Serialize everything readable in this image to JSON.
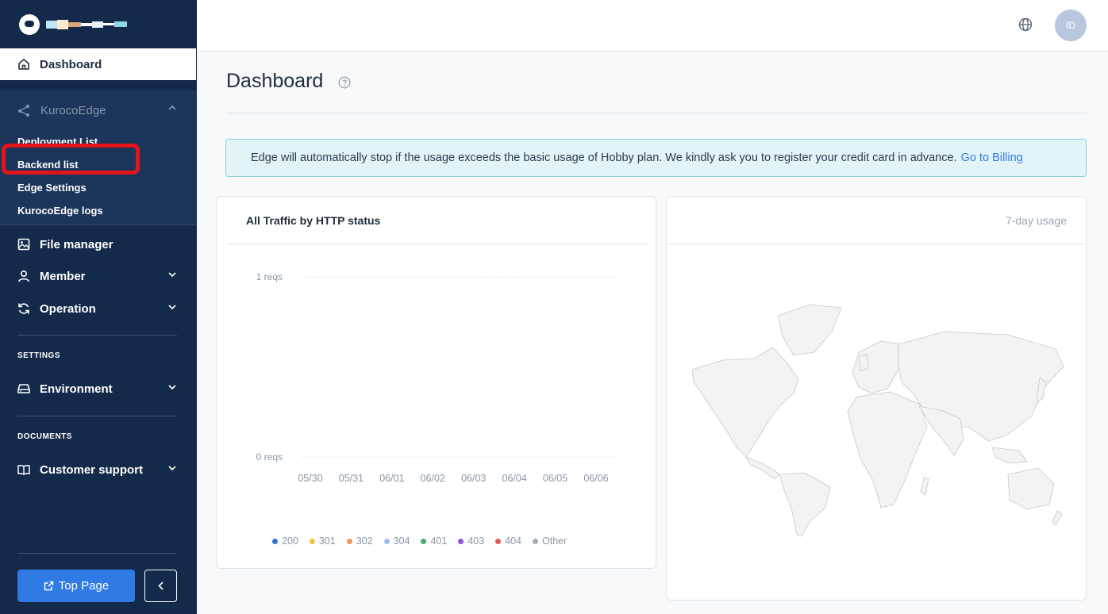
{
  "sidebar": {
    "dashboard_label": "Dashboard",
    "edge_group": {
      "label": "KurocoEdge",
      "items": [
        "Deployment List",
        "Backend list",
        "Edge Settings",
        "KurocoEdge logs"
      ]
    },
    "file_manager_label": "File manager",
    "member_label": "Member",
    "operation_label": "Operation",
    "settings_section": "SETTINGS",
    "environment_label": "Environment",
    "documents_section": "DOCUMENTS",
    "customer_support_label": "Customer support",
    "top_page_label": "Top Page"
  },
  "header": {
    "avatar_initials": "ID"
  },
  "main": {
    "title": "Dashboard",
    "alert_text": "Edge will automatically stop if the usage exceeds the basic usage of Hobby plan. We kindly ask you to register your credit card in advance.",
    "alert_link": "Go to Billing",
    "traffic_card_title": "All Traffic by HTTP status",
    "usage_card_title": "7-day usage"
  },
  "chart_data": {
    "type": "line",
    "title": "All Traffic by HTTP status",
    "categories": [
      "05/30",
      "05/31",
      "06/01",
      "06/02",
      "06/03",
      "06/04",
      "06/05",
      "06/06"
    ],
    "y_ticks": [
      "1 reqs",
      "0 reqs"
    ],
    "ylim": [
      0,
      1
    ],
    "series": [
      {
        "name": "200",
        "color": "#2f6fe0",
        "values": [
          0,
          0,
          0,
          0,
          0,
          0,
          0,
          0
        ]
      },
      {
        "name": "301",
        "color": "#f5c242",
        "values": [
          0,
          0,
          0,
          0,
          0,
          0,
          0,
          0
        ]
      },
      {
        "name": "302",
        "color": "#f0955a",
        "values": [
          0,
          0,
          0,
          0,
          0,
          0,
          0,
          0
        ]
      },
      {
        "name": "304",
        "color": "#9dbcf0",
        "values": [
          0,
          0,
          0,
          0,
          0,
          0,
          0,
          0
        ]
      },
      {
        "name": "401",
        "color": "#3fae6a",
        "values": [
          0,
          0,
          0,
          0,
          0,
          0,
          0,
          0
        ]
      },
      {
        "name": "403",
        "color": "#8e55d9",
        "values": [
          0,
          0,
          0,
          0,
          0,
          0,
          0,
          0
        ]
      },
      {
        "name": "404",
        "color": "#e05a5a",
        "values": [
          0,
          0,
          0,
          0,
          0,
          0,
          0,
          0
        ]
      },
      {
        "name": "Other",
        "color": "#a3acb8",
        "values": [
          0,
          0,
          0,
          0,
          0,
          0,
          0,
          0
        ]
      }
    ],
    "grid": true,
    "legend": "bottom"
  }
}
